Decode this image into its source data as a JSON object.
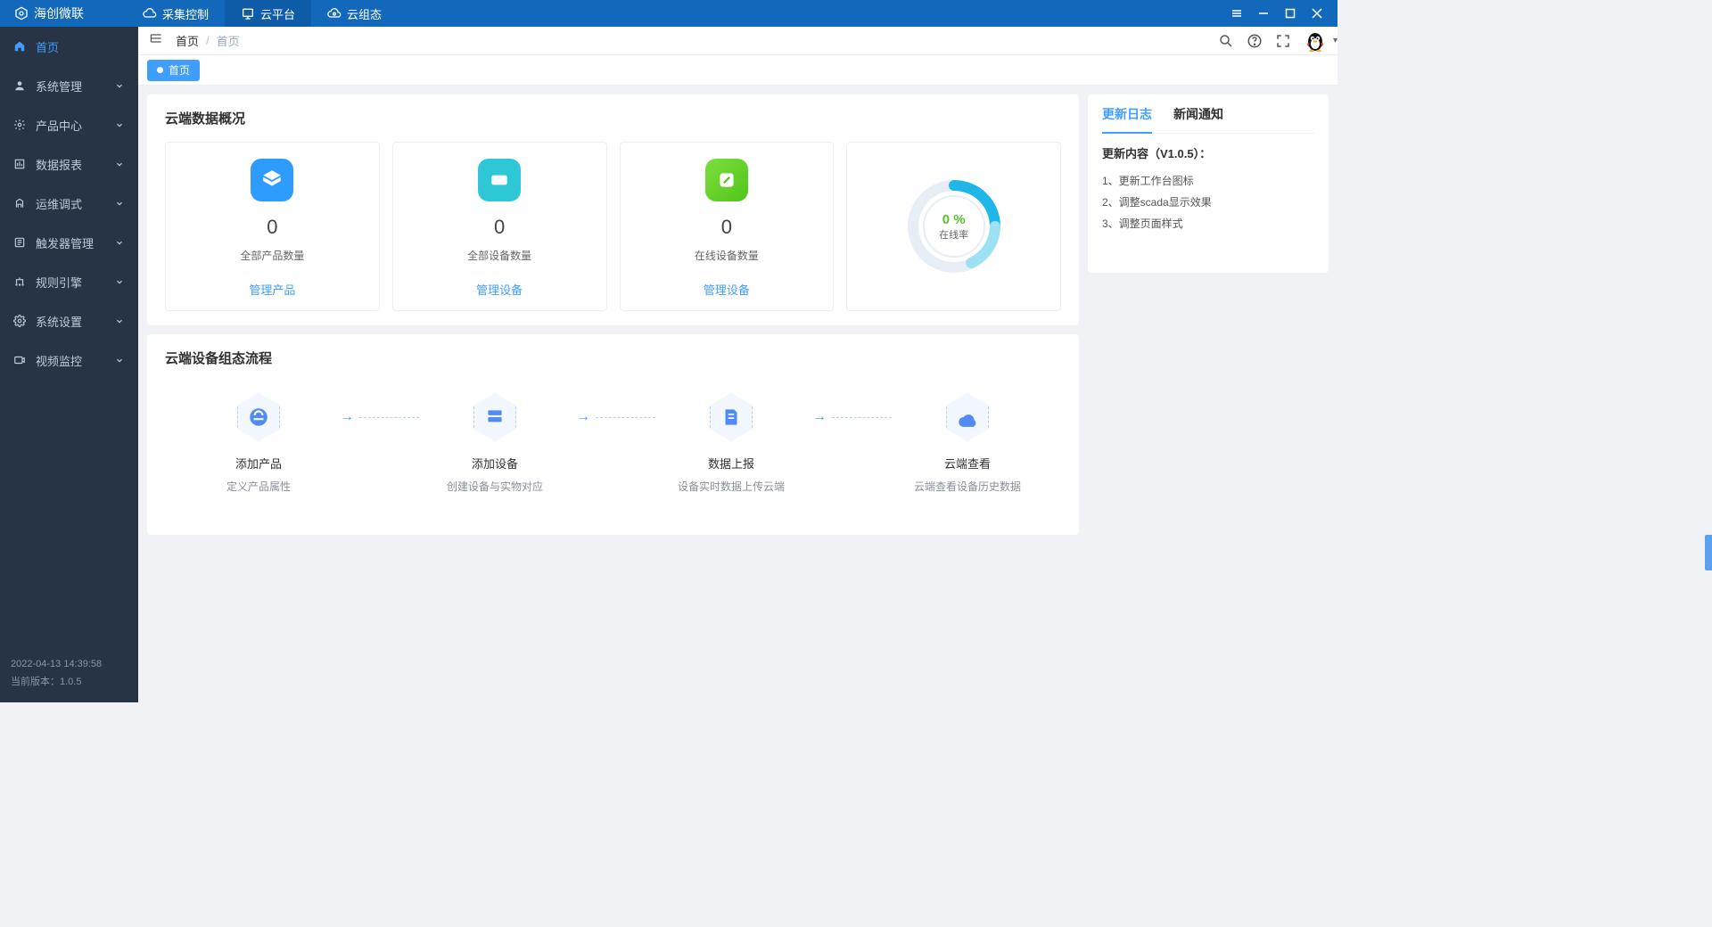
{
  "brand": {
    "name": "海创微联"
  },
  "top_tabs": [
    {
      "label": "采集控制",
      "active": false
    },
    {
      "label": "云平台",
      "active": true
    },
    {
      "label": "云组态",
      "active": false
    }
  ],
  "sidebar": {
    "items": [
      {
        "label": "首页",
        "expandable": false,
        "active": true
      },
      {
        "label": "系统管理",
        "expandable": true,
        "active": false
      },
      {
        "label": "产品中心",
        "expandable": true,
        "active": false
      },
      {
        "label": "数据报表",
        "expandable": true,
        "active": false
      },
      {
        "label": "运维调式",
        "expandable": true,
        "active": false
      },
      {
        "label": "触发器管理",
        "expandable": true,
        "active": false
      },
      {
        "label": "规则引擎",
        "expandable": true,
        "active": false
      },
      {
        "label": "系统设置",
        "expandable": true,
        "active": false
      },
      {
        "label": "视频监控",
        "expandable": true,
        "active": false
      }
    ],
    "footer_time": "2022-04-13 14:39:58",
    "footer_version": "当前版本：1.0.5"
  },
  "breadcrumb": {
    "root": "首页",
    "sep": "/",
    "current": "首页"
  },
  "page_tab": {
    "label": "首页"
  },
  "overview": {
    "title": "云端数据概况",
    "cards": [
      {
        "value": "0",
        "label": "全部产品数量",
        "link": "管理产品",
        "color": "blue"
      },
      {
        "value": "0",
        "label": "全部设备数量",
        "link": "管理设备",
        "color": "teal"
      },
      {
        "value": "0",
        "label": "在线设备数量",
        "link": "管理设备",
        "color": "green"
      }
    ],
    "gauge": {
      "percent_text": "0 %",
      "label": "在线率",
      "percent": 0
    }
  },
  "flow": {
    "title": "云端设备组态流程",
    "steps": [
      {
        "title": "添加产品",
        "sub": "定义产品属性"
      },
      {
        "title": "添加设备",
        "sub": "创建设备与实物对应"
      },
      {
        "title": "数据上报",
        "sub": "设备实时数据上传云端"
      },
      {
        "title": "云端查看",
        "sub": "云端查看设备历史数据"
      }
    ]
  },
  "right": {
    "tabs": [
      {
        "label": "更新日志",
        "active": true
      },
      {
        "label": "新闻通知",
        "active": false
      }
    ],
    "log_title": "更新内容（V1.0.5）：",
    "log_items": [
      "1、更新工作台图标",
      "2、调整scada显示效果",
      "3、调整页面样式"
    ]
  },
  "chart_data": {
    "type": "pie",
    "title": "在线率",
    "series": [
      {
        "name": "在线率",
        "values": [
          0
        ]
      }
    ],
    "categories": [
      "在线率"
    ],
    "percent": 0,
    "ylim": [
      0,
      100
    ]
  },
  "colors": {
    "primary": "#409eff",
    "titlebar": "#1268bb",
    "sidebar": "#263445"
  }
}
